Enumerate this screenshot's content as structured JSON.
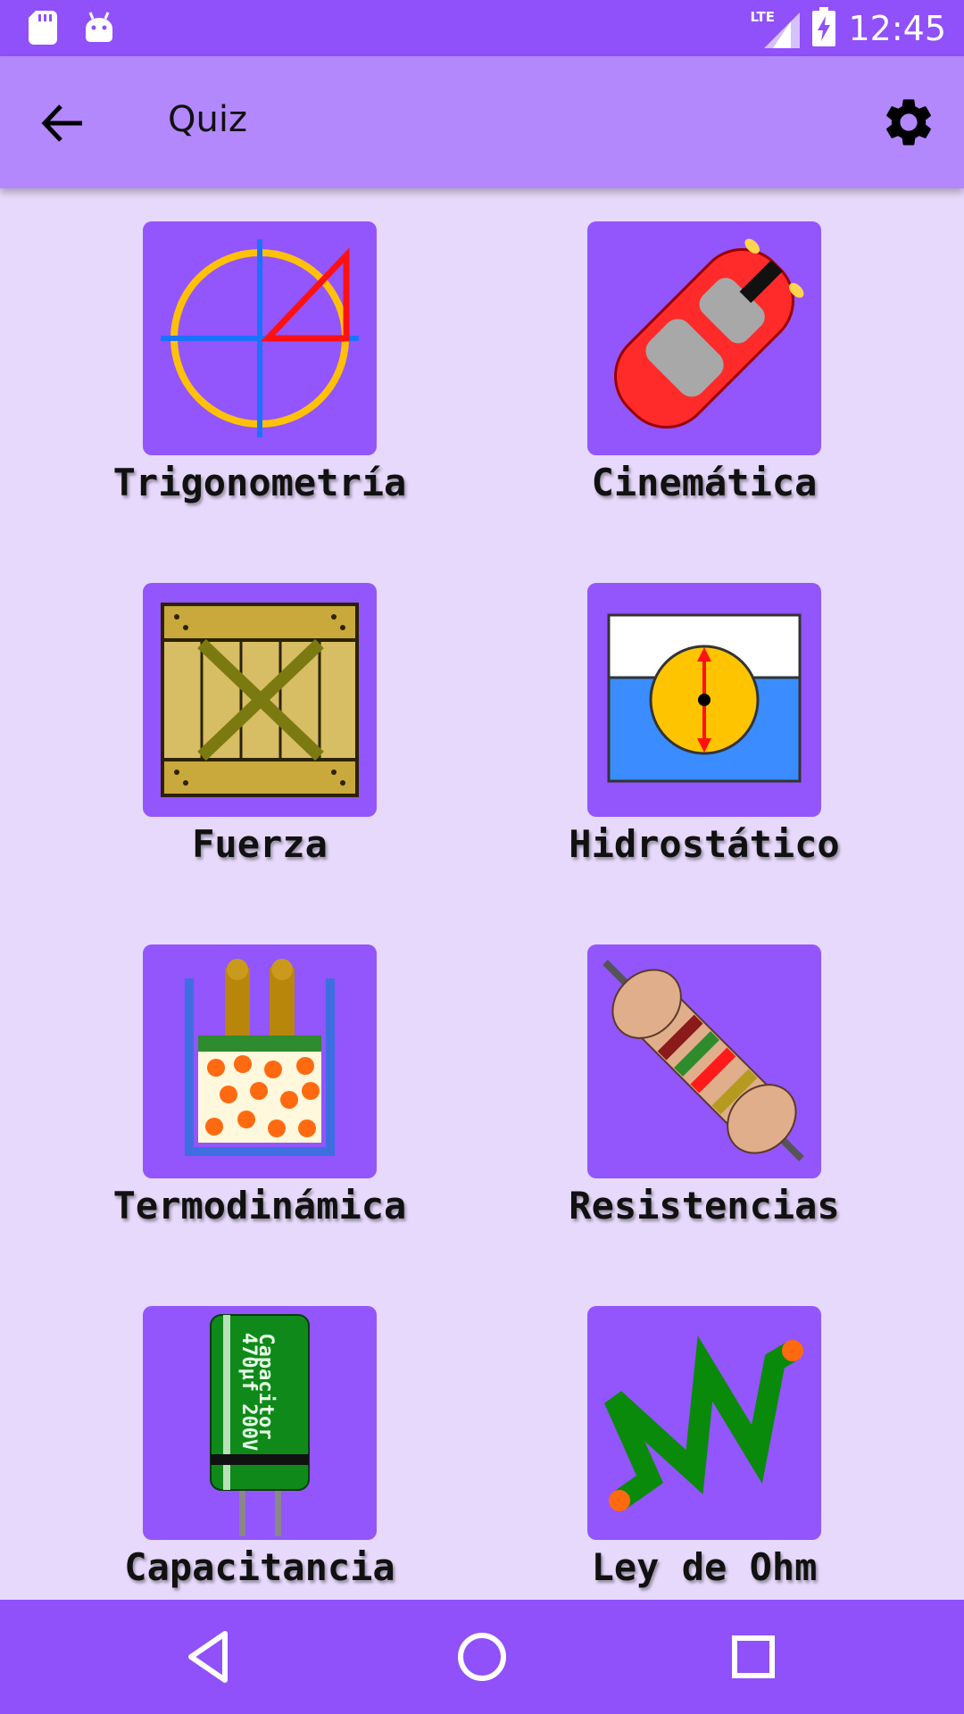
{
  "status_bar": {
    "time": "12:45",
    "network": "LTE",
    "left_icons": [
      "sd-card-icon",
      "android-icon"
    ],
    "right_icons": [
      "signal-icon",
      "battery-charging-icon"
    ]
  },
  "app_bar": {
    "title": "Quiz",
    "back_icon": "arrow-back-icon",
    "settings_icon": "gear-icon"
  },
  "topics": [
    {
      "label": "Trigonometría",
      "icon": "trigonometry-icon"
    },
    {
      "label": "Cinemática",
      "icon": "car-icon"
    },
    {
      "label": "Fuerza",
      "icon": "crate-icon"
    },
    {
      "label": "Hidrostático",
      "icon": "buoyancy-icon"
    },
    {
      "label": "Termodinámica",
      "icon": "piston-gas-icon"
    },
    {
      "label": "Resistencias",
      "icon": "resistor-icon"
    },
    {
      "label": "Capacitancia",
      "icon": "capacitor-icon"
    },
    {
      "label": "Ley de Ohm",
      "icon": "zigzag-resistor-icon"
    }
  ],
  "nav_bar": {
    "back_icon": "nav-back-icon",
    "home_icon": "nav-home-icon",
    "recents_icon": "nav-recents-icon"
  },
  "colors": {
    "status_bar": "#9050fa",
    "app_bar": "#b388fd",
    "background": "#e7d9fb",
    "tile": "#9355fc",
    "nav_bar": "#9050fa"
  }
}
